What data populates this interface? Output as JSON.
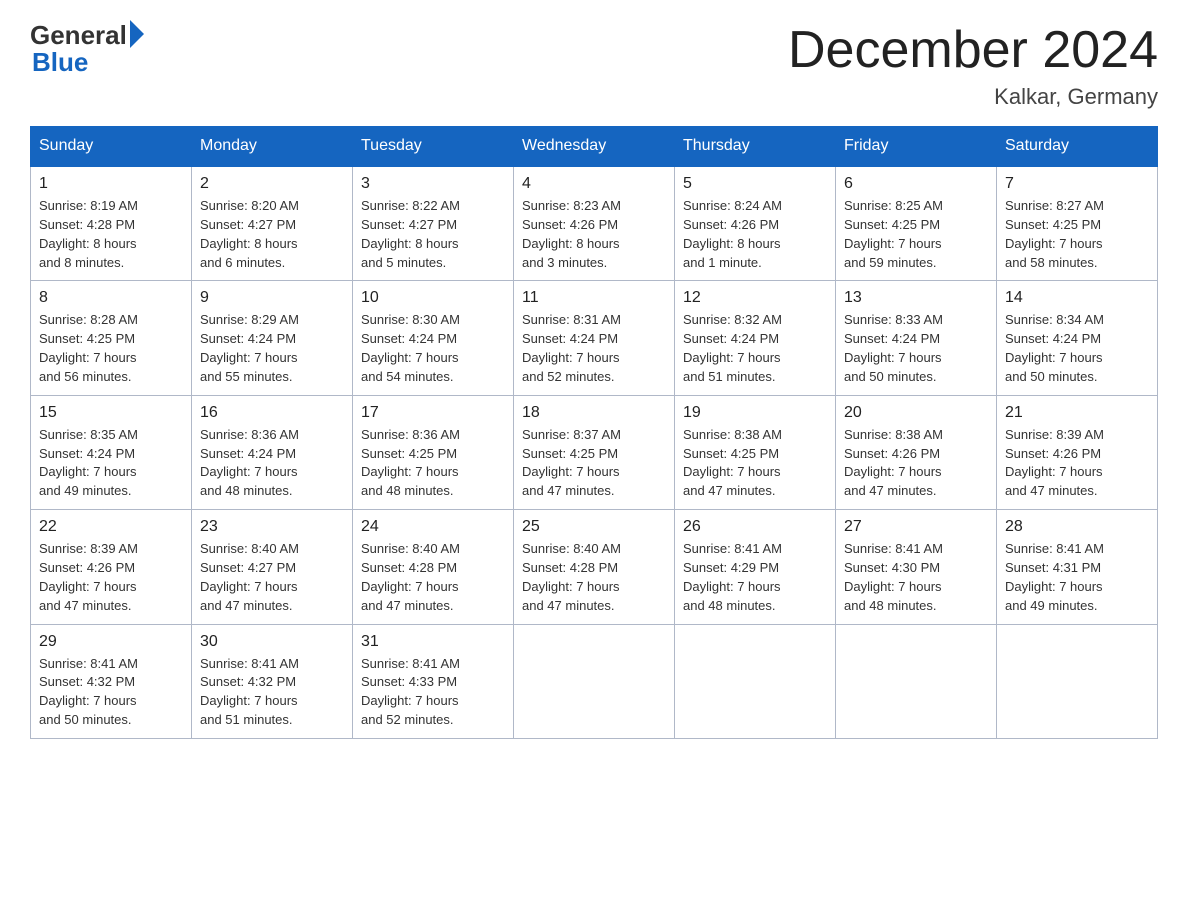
{
  "header": {
    "logo_general": "General",
    "logo_blue": "Blue",
    "month_title": "December 2024",
    "location": "Kalkar, Germany"
  },
  "weekdays": [
    "Sunday",
    "Monday",
    "Tuesday",
    "Wednesday",
    "Thursday",
    "Friday",
    "Saturday"
  ],
  "weeks": [
    [
      {
        "day": "1",
        "sunrise": "8:19 AM",
        "sunset": "4:28 PM",
        "daylight": "8 hours and 8 minutes."
      },
      {
        "day": "2",
        "sunrise": "8:20 AM",
        "sunset": "4:27 PM",
        "daylight": "8 hours and 6 minutes."
      },
      {
        "day": "3",
        "sunrise": "8:22 AM",
        "sunset": "4:27 PM",
        "daylight": "8 hours and 5 minutes."
      },
      {
        "day": "4",
        "sunrise": "8:23 AM",
        "sunset": "4:26 PM",
        "daylight": "8 hours and 3 minutes."
      },
      {
        "day": "5",
        "sunrise": "8:24 AM",
        "sunset": "4:26 PM",
        "daylight": "8 hours and 1 minute."
      },
      {
        "day": "6",
        "sunrise": "8:25 AM",
        "sunset": "4:25 PM",
        "daylight": "7 hours and 59 minutes."
      },
      {
        "day": "7",
        "sunrise": "8:27 AM",
        "sunset": "4:25 PM",
        "daylight": "7 hours and 58 minutes."
      }
    ],
    [
      {
        "day": "8",
        "sunrise": "8:28 AM",
        "sunset": "4:25 PM",
        "daylight": "7 hours and 56 minutes."
      },
      {
        "day": "9",
        "sunrise": "8:29 AM",
        "sunset": "4:24 PM",
        "daylight": "7 hours and 55 minutes."
      },
      {
        "day": "10",
        "sunrise": "8:30 AM",
        "sunset": "4:24 PM",
        "daylight": "7 hours and 54 minutes."
      },
      {
        "day": "11",
        "sunrise": "8:31 AM",
        "sunset": "4:24 PM",
        "daylight": "7 hours and 52 minutes."
      },
      {
        "day": "12",
        "sunrise": "8:32 AM",
        "sunset": "4:24 PM",
        "daylight": "7 hours and 51 minutes."
      },
      {
        "day": "13",
        "sunrise": "8:33 AM",
        "sunset": "4:24 PM",
        "daylight": "7 hours and 50 minutes."
      },
      {
        "day": "14",
        "sunrise": "8:34 AM",
        "sunset": "4:24 PM",
        "daylight": "7 hours and 50 minutes."
      }
    ],
    [
      {
        "day": "15",
        "sunrise": "8:35 AM",
        "sunset": "4:24 PM",
        "daylight": "7 hours and 49 minutes."
      },
      {
        "day": "16",
        "sunrise": "8:36 AM",
        "sunset": "4:24 PM",
        "daylight": "7 hours and 48 minutes."
      },
      {
        "day": "17",
        "sunrise": "8:36 AM",
        "sunset": "4:25 PM",
        "daylight": "7 hours and 48 minutes."
      },
      {
        "day": "18",
        "sunrise": "8:37 AM",
        "sunset": "4:25 PM",
        "daylight": "7 hours and 47 minutes."
      },
      {
        "day": "19",
        "sunrise": "8:38 AM",
        "sunset": "4:25 PM",
        "daylight": "7 hours and 47 minutes."
      },
      {
        "day": "20",
        "sunrise": "8:38 AM",
        "sunset": "4:26 PM",
        "daylight": "7 hours and 47 minutes."
      },
      {
        "day": "21",
        "sunrise": "8:39 AM",
        "sunset": "4:26 PM",
        "daylight": "7 hours and 47 minutes."
      }
    ],
    [
      {
        "day": "22",
        "sunrise": "8:39 AM",
        "sunset": "4:26 PM",
        "daylight": "7 hours and 47 minutes."
      },
      {
        "day": "23",
        "sunrise": "8:40 AM",
        "sunset": "4:27 PM",
        "daylight": "7 hours and 47 minutes."
      },
      {
        "day": "24",
        "sunrise": "8:40 AM",
        "sunset": "4:28 PM",
        "daylight": "7 hours and 47 minutes."
      },
      {
        "day": "25",
        "sunrise": "8:40 AM",
        "sunset": "4:28 PM",
        "daylight": "7 hours and 47 minutes."
      },
      {
        "day": "26",
        "sunrise": "8:41 AM",
        "sunset": "4:29 PM",
        "daylight": "7 hours and 48 minutes."
      },
      {
        "day": "27",
        "sunrise": "8:41 AM",
        "sunset": "4:30 PM",
        "daylight": "7 hours and 48 minutes."
      },
      {
        "day": "28",
        "sunrise": "8:41 AM",
        "sunset": "4:31 PM",
        "daylight": "7 hours and 49 minutes."
      }
    ],
    [
      {
        "day": "29",
        "sunrise": "8:41 AM",
        "sunset": "4:32 PM",
        "daylight": "7 hours and 50 minutes."
      },
      {
        "day": "30",
        "sunrise": "8:41 AM",
        "sunset": "4:32 PM",
        "daylight": "7 hours and 51 minutes."
      },
      {
        "day": "31",
        "sunrise": "8:41 AM",
        "sunset": "4:33 PM",
        "daylight": "7 hours and 52 minutes."
      },
      null,
      null,
      null,
      null
    ]
  ]
}
